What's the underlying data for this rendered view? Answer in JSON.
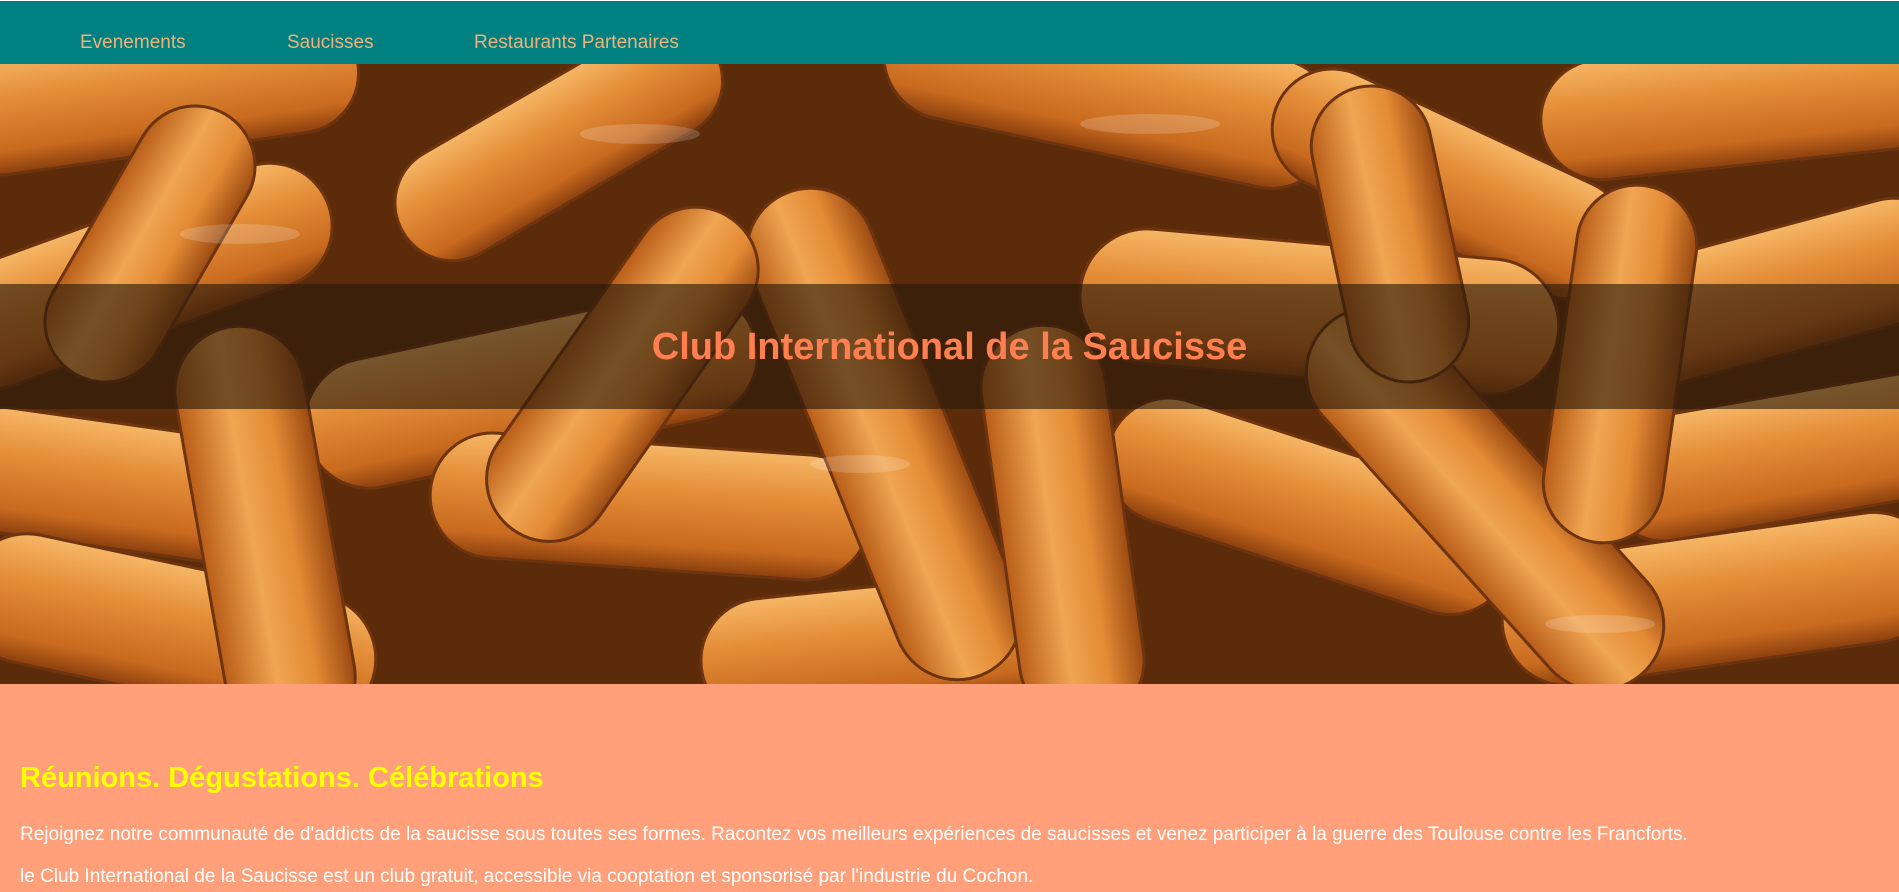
{
  "nav": {
    "items": [
      {
        "label": "Evenements"
      },
      {
        "label": "Saucisses"
      },
      {
        "label": "Restaurants Partenaires"
      }
    ]
  },
  "hero": {
    "title": "Club International de la Saucisse",
    "image": "sausages-photo"
  },
  "content": {
    "heading": "Réunions. Dégustations. Célébrations",
    "paragraphs": [
      "Rejoignez notre communauté de d'addicts de la saucisse sous toutes ses formes. Racontez vos meilleurs expériences de saucisses et venez participer à la guerre des Toulouse contre les Francforts.",
      "le Club International de la Saucisse est un club gratuit, accessible via cooptation et sponsorisé par l'industrie du Cochon."
    ]
  },
  "colors": {
    "nav_bg": "#008080",
    "nav_text": "#f0b27a",
    "title": "#ff7f50",
    "content_bg": "#ffa07a",
    "heading": "#ffff00",
    "body_text": "#ffffff"
  }
}
